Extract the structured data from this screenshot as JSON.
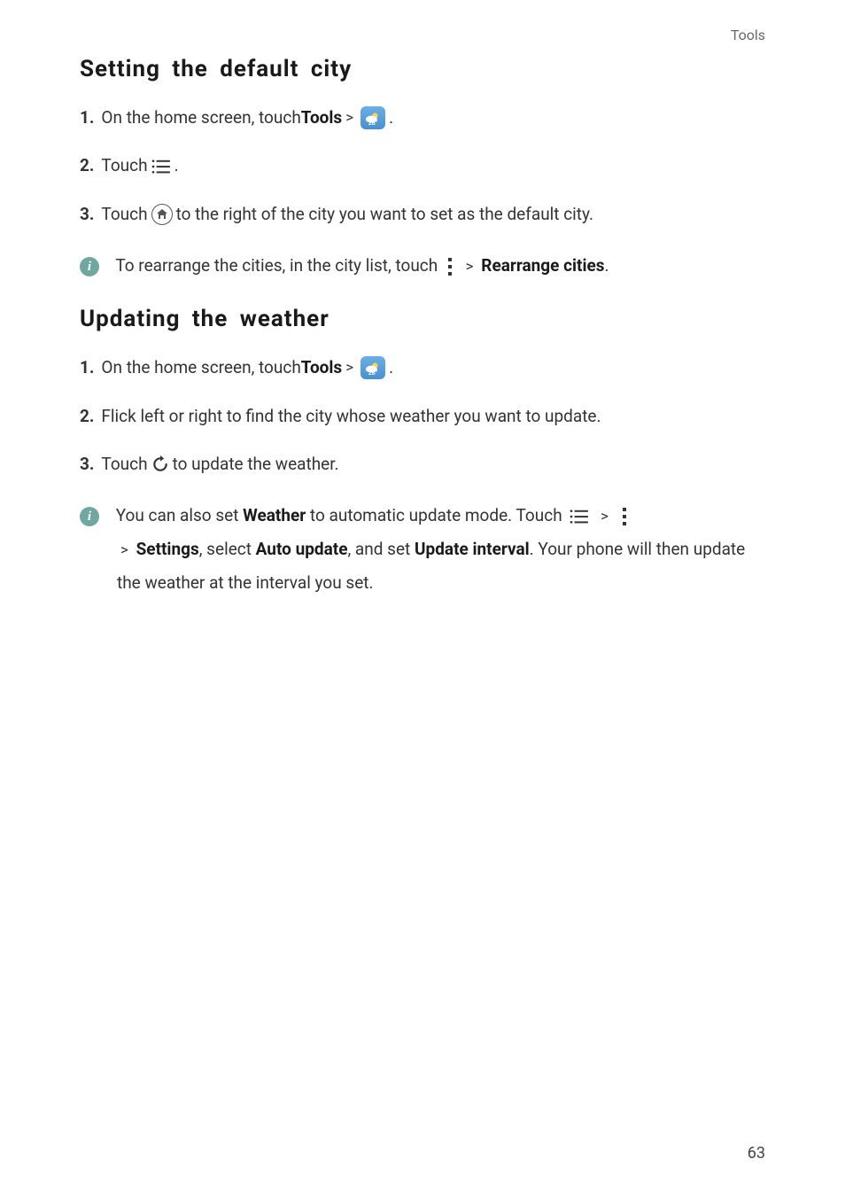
{
  "header": {
    "category": "Tools"
  },
  "section1": {
    "title": "Setting  the  default  city",
    "step1_a": "On the home screen, touch ",
    "step1_tools": "Tools",
    "step2_a": "Touch ",
    "step3_a": "Touch ",
    "step3_b": " to the right of the city you want to set as the default city.",
    "note_a": "To rearrange the cities, in the city list, touch ",
    "note_b": "Rearrange cities"
  },
  "section2": {
    "title": "Updating  the  weather",
    "step1_a": "On the home screen, touch ",
    "step1_tools": "Tools",
    "step2_a": "Flick left or right to find the city whose weather you want to update.",
    "step3_a": "Touch ",
    "step3_b": " to update the weather.",
    "note_a": "You can also set ",
    "note_weather": "Weather",
    "note_b": " to automatic update mode. Touch ",
    "note_c": "Settings",
    "note_d": ", select ",
    "note_e": "Auto update",
    "note_f": ", and set ",
    "note_g": "Update interval",
    "note_h": ". Your phone will then update the weather at the interval you set."
  },
  "labels": {
    "n1": "1.",
    "n2": "2.",
    "n3": "3.",
    "gt": ">",
    "dot": "."
  },
  "page": "63",
  "icons": {
    "weather_temp": "28°"
  }
}
